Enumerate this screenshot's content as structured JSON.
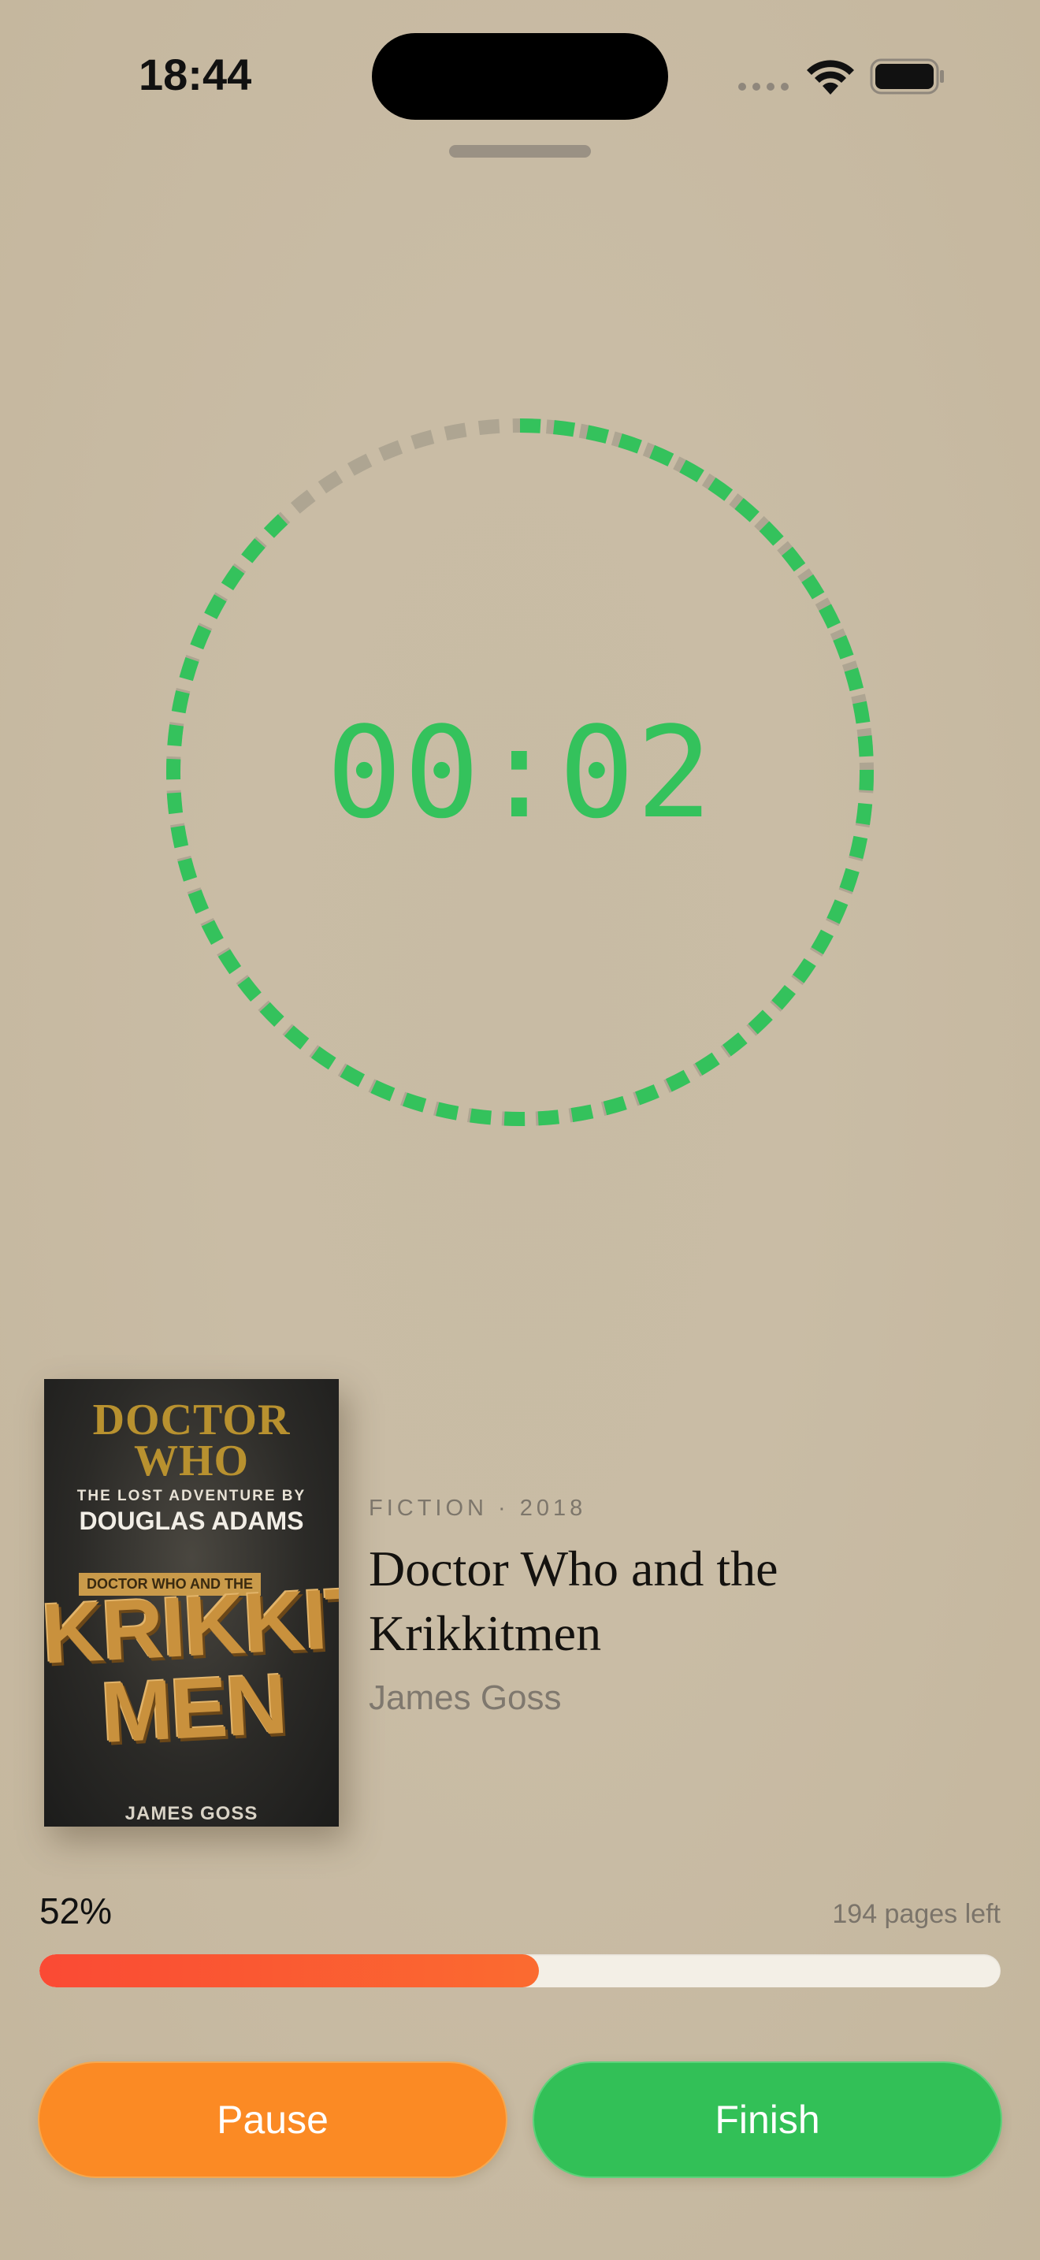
{
  "status_bar": {
    "time": "18:44",
    "wifi_icon": "wifi-icon",
    "battery_icon": "battery-icon"
  },
  "timer": {
    "display": "00:02",
    "ring_progress": 0.88,
    "ring_active_color": "#34c25c",
    "ring_inactive_color": "#aea592"
  },
  "book": {
    "cover": {
      "series_line1": "DOCTOR",
      "series_line2": "WHO",
      "tagline": "THE LOST ADVENTURE BY",
      "author_top": "DOUGLAS ADAMS",
      "subtitle_tag": "DOCTOR WHO AND THE",
      "title_line1": "KRIKKIT",
      "title_line2": "MEN",
      "author_bottom": "JAMES GOSS"
    },
    "genre_year": "FICTION · 2018",
    "title": "Doctor Who and the Krikkitmen",
    "author": "James Goss"
  },
  "progress": {
    "percent_label": "52%",
    "fraction": 0.52,
    "pages_left": "194 pages left",
    "fill_color": "#fa4a34"
  },
  "actions": {
    "pause_label": "Pause",
    "finish_label": "Finish",
    "pause_color": "#fb8a24",
    "finish_color": "#32c057"
  }
}
